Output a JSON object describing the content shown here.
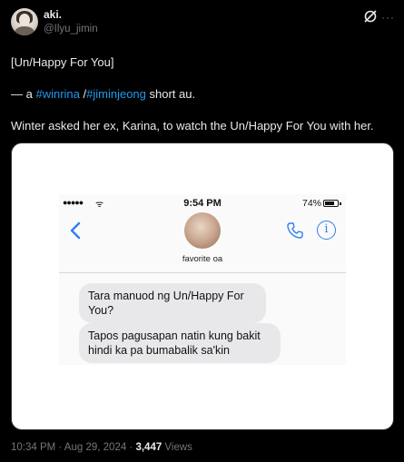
{
  "post": {
    "author_name": "aki.",
    "author_handle": "@Ilyu_jimin",
    "more_label": "···",
    "title_line": "[Un/Happy For You]",
    "line2_prefix": "— a ",
    "hashtag1": "#winrina",
    "line2_sep": " /",
    "hashtag2": "#jiminjeong",
    "line2_suffix": " short au.",
    "line3": "Winter asked her ex, Karina, to watch the Un/Happy For You with her.",
    "timestamp": "10:34 PM · Aug 29, 2024 · ",
    "views_count": "3,447",
    "views_label": " Views"
  },
  "screenshot": {
    "statusbar": {
      "signal": "●●●●●",
      "wifi": "ᯤ",
      "time": "9:54 PM",
      "battery": "74%"
    },
    "contact_name": "favorite oa",
    "info_glyph": "i",
    "messages": [
      "Tara manuod ng Un/Happy For You?",
      "Tapos pagusapan natin kung bakit hindi ka pa bumabalik sa'kin"
    ]
  },
  "colors": {
    "link": "#1d9bf0",
    "ios_blue": "#2f7ff0",
    "muted": "#71767b"
  },
  "icons": [
    "grok-icon",
    "more-icon",
    "back-icon",
    "phone-icon",
    "info-icon"
  ]
}
